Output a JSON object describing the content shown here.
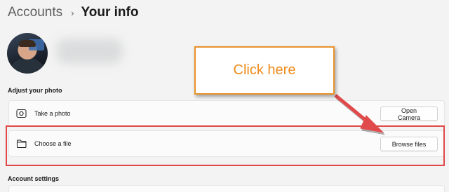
{
  "breadcrumb": {
    "parent": "Accounts",
    "separator": "›",
    "current": "Your info"
  },
  "profile": {
    "avatar_icon": "avatar"
  },
  "sections": {
    "adjust_photo": "Adjust your photo",
    "account_settings": "Account settings"
  },
  "photo_options": [
    {
      "icon": "camera-icon",
      "label": "Take a photo",
      "button": "Open Camera"
    },
    {
      "icon": "folder-icon",
      "label": "Choose a file",
      "button": "Browse files"
    }
  ],
  "annotation": {
    "callout_text": "Click here",
    "callout_border_color": "#e8922a",
    "callout_text_color": "#ef8c1e",
    "highlight_color": "#e04a4a",
    "arrow_color": "#e04a4a"
  }
}
